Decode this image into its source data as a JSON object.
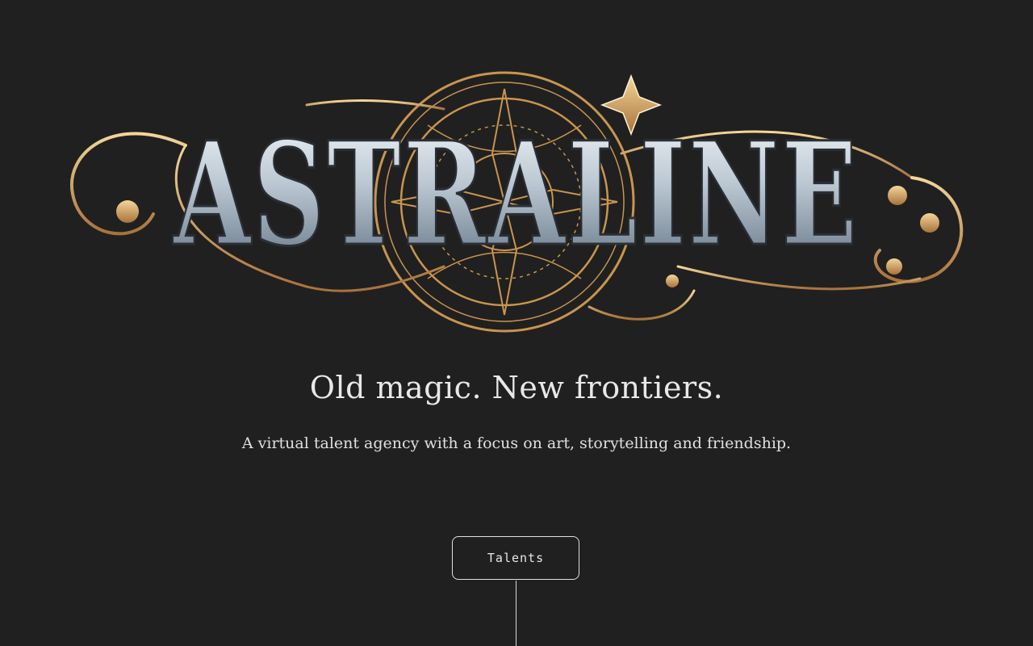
{
  "logo": {
    "wordmark": "ASTRALINE",
    "colors": {
      "gold": "#c9954f",
      "gold_light": "#f0cf8e",
      "silver_light": "#eef2f5",
      "silver_dark": "#6f8090",
      "background": "#202020"
    }
  },
  "hero": {
    "tagline": "Old magic. New frontiers.",
    "description": "A virtual talent agency with a focus on art, storytelling and friendship."
  },
  "nav": {
    "talents_label": "Talents"
  }
}
